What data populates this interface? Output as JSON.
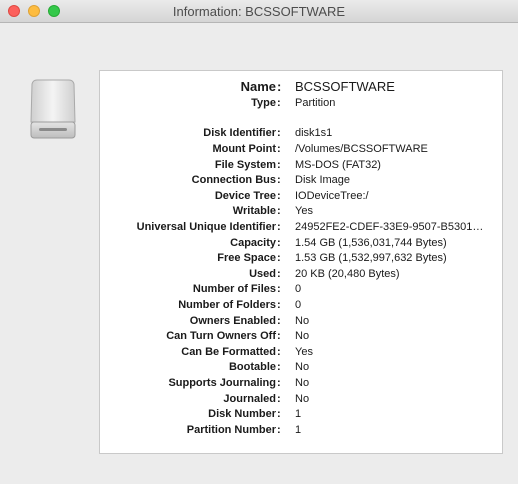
{
  "window": {
    "title": "Information: BCSSOFTWARE",
    "icon": "external-drive-icon"
  },
  "info": {
    "rows": [
      {
        "key": "Name",
        "value": "BCSSOFTWARE"
      },
      {
        "key": "Type",
        "value": "Partition"
      },
      {
        "key": "Disk Identifier",
        "value": "disk1s1"
      },
      {
        "key": "Mount Point",
        "value": "/Volumes/BCSSOFTWARE"
      },
      {
        "key": "File System",
        "value": "MS-DOS (FAT32)"
      },
      {
        "key": "Connection Bus",
        "value": "Disk Image"
      },
      {
        "key": "Device Tree",
        "value": "IODeviceTree:/"
      },
      {
        "key": "Writable",
        "value": "Yes"
      },
      {
        "key": "Universal Unique Identifier",
        "value": "24952FE2-CDEF-33E9-9507-B5301…"
      },
      {
        "key": "Capacity",
        "value": "1.54 GB (1,536,031,744 Bytes)"
      },
      {
        "key": "Free Space",
        "value": "1.53 GB (1,532,997,632 Bytes)"
      },
      {
        "key": "Used",
        "value": "20 KB (20,480 Bytes)"
      },
      {
        "key": "Number of Files",
        "value": "0"
      },
      {
        "key": "Number of Folders",
        "value": "0"
      },
      {
        "key": "Owners Enabled",
        "value": "No"
      },
      {
        "key": "Can Turn Owners Off",
        "value": "No"
      },
      {
        "key": "Can Be Formatted",
        "value": "Yes"
      },
      {
        "key": "Bootable",
        "value": "No"
      },
      {
        "key": "Supports Journaling",
        "value": "No"
      },
      {
        "key": "Journaled",
        "value": "No"
      },
      {
        "key": "Disk Number",
        "value": "1"
      },
      {
        "key": "Partition Number",
        "value": "1"
      }
    ]
  }
}
